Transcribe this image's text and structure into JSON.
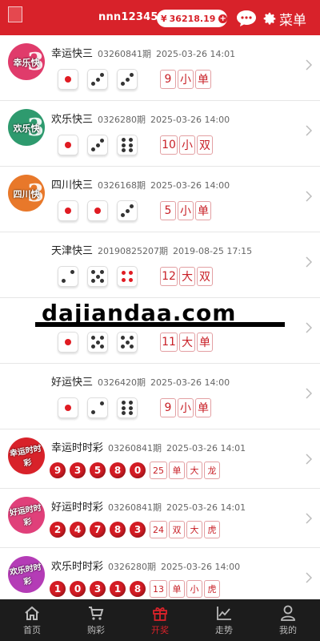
{
  "header": {
    "username": "nnn123456",
    "balance_symbol": "¥",
    "balance": "36218.19",
    "balance_plus": "+",
    "menu_label": "菜单",
    "bg_color": "#d8222a"
  },
  "games": [
    {
      "badge_text": "幸乐快3",
      "badge_color": "#e03b6b",
      "name": "幸运快三",
      "period": "03260841期",
      "time": "2025-03-26 14:01",
      "dice": [
        1,
        3,
        3
      ],
      "sum": "9",
      "size": "小",
      "parity": "单"
    },
    {
      "badge_text": "欢乐快3",
      "badge_color": "#2e9a6e",
      "name": "欢乐快三",
      "period": "0326280期",
      "time": "2025-03-26 14:00",
      "dice": [
        1,
        3,
        6
      ],
      "sum": "10",
      "size": "小",
      "parity": "双"
    },
    {
      "badge_text": "四川快3",
      "badge_color": "#e8782a",
      "name": "四川快三",
      "period": "0326168期",
      "time": "2025-03-26 14:00",
      "dice": [
        1,
        1,
        3
      ],
      "sum": "5",
      "size": "小",
      "parity": "单"
    },
    {
      "badge_text": "",
      "badge_color": "",
      "name": "天津快三",
      "period": "20190825207期",
      "time": "2019-08-25 17:15",
      "dice": [
        2,
        5,
        4
      ],
      "sum": "12",
      "size": "大",
      "parity": "双"
    },
    {
      "badge_text": "",
      "badge_color": "",
      "name": "",
      "period": "",
      "time": "",
      "dice": [
        1,
        5,
        5
      ],
      "sum": "11",
      "size": "大",
      "parity": "单"
    },
    {
      "badge_text": "",
      "badge_color": "",
      "name": "好运快三",
      "period": "0326420期",
      "time": "2025-03-26 14:00",
      "dice": [
        1,
        2,
        6
      ],
      "sum": "9",
      "size": "小",
      "parity": "单"
    }
  ],
  "lotteries": [
    {
      "badge_text": "幸运时时彩",
      "badge_color": "#d8222a",
      "name": "幸运时时彩",
      "period": "03260841期",
      "time": "2025-03-26 14:01",
      "balls": [
        "9",
        "3",
        "5",
        "8",
        "0"
      ],
      "sum": "25",
      "tags": [
        "单",
        "大",
        "龙"
      ]
    },
    {
      "badge_text": "好运时时彩",
      "badge_color": "#e0407a",
      "name": "好运时时彩",
      "period": "03260841期",
      "time": "2025-03-26 14:01",
      "balls": [
        "2",
        "4",
        "7",
        "8",
        "3"
      ],
      "sum": "24",
      "tags": [
        "双",
        "大",
        "虎"
      ]
    },
    {
      "badge_text": "欢乐时时彩",
      "badge_color": "#b43cb6",
      "name": "欢乐时时彩",
      "period": "0326280期",
      "time": "2025-03-26 14:00",
      "balls": [
        "1",
        "0",
        "3",
        "1",
        "8"
      ],
      "sum": "13",
      "tags": [
        "单",
        "小",
        "虎"
      ]
    }
  ],
  "watermark": "dajiandaa.com",
  "tabs": [
    {
      "label": "首页",
      "icon": "home-icon"
    },
    {
      "label": "购彩",
      "icon": "cart-icon"
    },
    {
      "label": "开奖",
      "icon": "gift-icon",
      "active": true
    },
    {
      "label": "走势",
      "icon": "chart-icon"
    },
    {
      "label": "我的",
      "icon": "user-icon"
    }
  ]
}
